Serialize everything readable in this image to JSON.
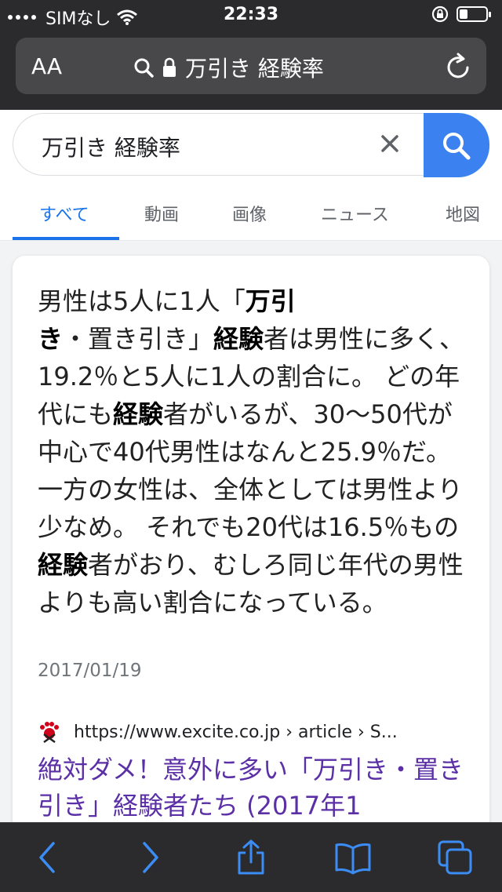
{
  "status": {
    "carrier": "SIMなし",
    "time": "22:33"
  },
  "browser": {
    "text_size_label": "AA",
    "url_display": "万引き 経験率"
  },
  "search": {
    "query": "万引き 経験率"
  },
  "tabs": [
    {
      "label": "すべて",
      "active": true
    },
    {
      "label": "動画"
    },
    {
      "label": "画像"
    },
    {
      "label": "ニュース"
    },
    {
      "label": "地図"
    }
  ],
  "result": {
    "snippet": [
      {
        "text": "男性は5人に1人「",
        "bold": false
      },
      {
        "text": "万引き",
        "bold": true
      },
      {
        "text": "・置き引き」",
        "bold": false
      },
      {
        "text": "経験",
        "bold": true
      },
      {
        "text": "者は男性に多く、19.2％と5人に1人の割合に。 どの年代にも",
        "bold": false
      },
      {
        "text": "経験",
        "bold": true
      },
      {
        "text": "者がいるが、30〜50代が中心で40代男性はなんと25.9％だ。 一方の女性は、全体としては男性より少なめ。 それでも20代は16.5％もの",
        "bold": false
      },
      {
        "text": "経験",
        "bold": true
      },
      {
        "text": "者がおり、むしろ同じ年代の男性よりも高い割合になっている。",
        "bold": false
      }
    ],
    "date": "2017/01/19",
    "source_url": "https://www.excite.co.jp › article › S...",
    "title": "絶対ダメ！意外に多い「万引き・置き引き」経験者たち (2017年1"
  },
  "colors": {
    "accent": "#1a73e8",
    "search_button": "#3b82f0",
    "visited_link": "#5b2fa6",
    "chrome_dark": "#2b2b2d",
    "ios_blue": "#3b8df5"
  },
  "icons": {
    "status": [
      "signal-dots-icon",
      "wifi-icon",
      "orientation-lock-icon",
      "battery-icon"
    ],
    "browser": [
      "search-icon",
      "lock-icon",
      "reload-icon"
    ],
    "toolbar": [
      "back-icon",
      "forward-icon",
      "share-icon",
      "bookmarks-icon",
      "tabs-icon"
    ]
  }
}
